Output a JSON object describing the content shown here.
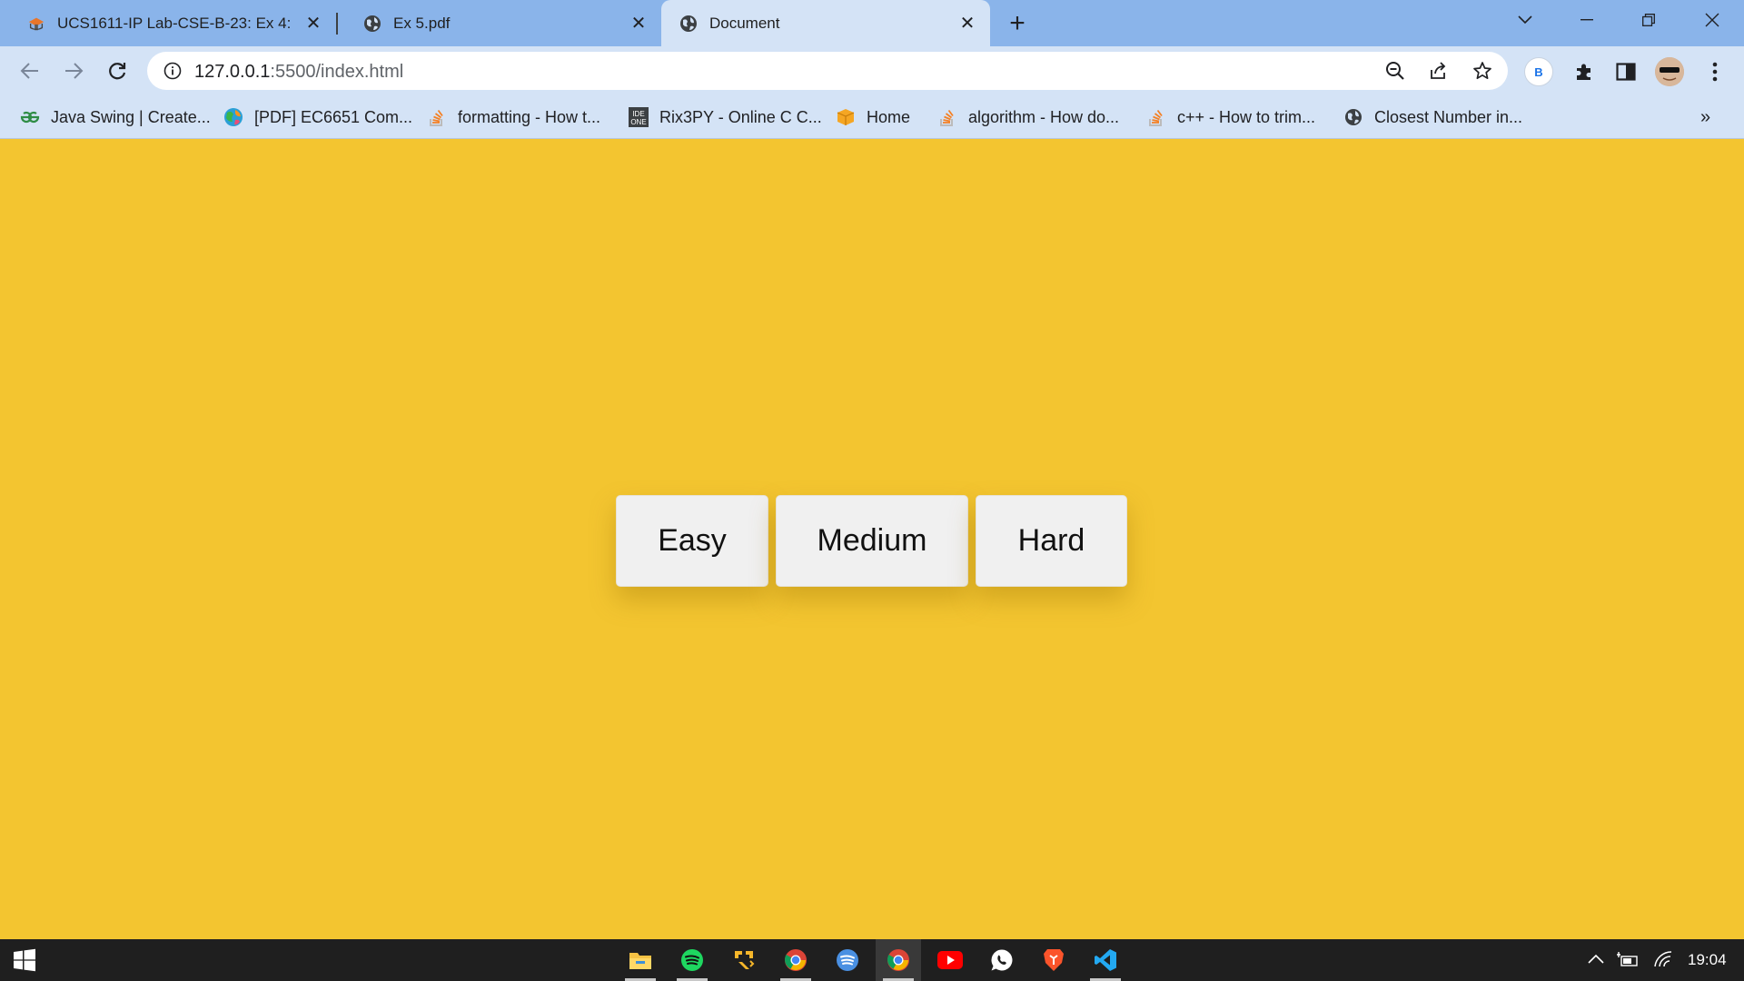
{
  "browser": {
    "tabs": [
      {
        "title": "UCS1611-IP Lab-CSE-B-23: Ex 4: ",
        "icon": "moodle-cap-icon"
      },
      {
        "title": "Ex 5.pdf",
        "icon": "globe-icon"
      },
      {
        "title": "Document",
        "icon": "globe-icon",
        "active": true
      }
    ],
    "close_glyph": "✕",
    "new_tab_glyph": "+",
    "url_host": "127.0.0.1",
    "url_rest": ":5500/index.html",
    "profile_initial": "B"
  },
  "bookmarks": [
    {
      "label": "Java Swing | Create...",
      "icon": "geeksforgeeks-icon"
    },
    {
      "label": "[PDF] EC6651 Com...",
      "icon": "colorful-globe-icon"
    },
    {
      "label": "formatting - How t...",
      "icon": "stackoverflow-icon"
    },
    {
      "label": "Rix3PY - Online C C...",
      "icon": "ideone-icon"
    },
    {
      "label": "Home",
      "icon": "box-icon"
    },
    {
      "label": "algorithm - How do...",
      "icon": "stackoverflow-icon"
    },
    {
      "label": "c++ - How to trim...",
      "icon": "stackoverflow-icon"
    },
    {
      "label": "Closest Number in...",
      "icon": "globe-icon"
    }
  ],
  "bookmarks_more": "»",
  "page": {
    "background": "#f3c530",
    "buttons": [
      {
        "label": "Easy"
      },
      {
        "label": "Medium"
      },
      {
        "label": "Hard"
      }
    ]
  },
  "taskbar": {
    "apps": [
      "file-explorer-icon",
      "spotify-icon",
      "git-tool-icon",
      "chrome-icon",
      "spotify-alt-icon",
      "chrome-icon",
      "youtube-icon",
      "whatsapp-icon",
      "brave-icon",
      "vscode-icon"
    ],
    "time": "19:04"
  }
}
